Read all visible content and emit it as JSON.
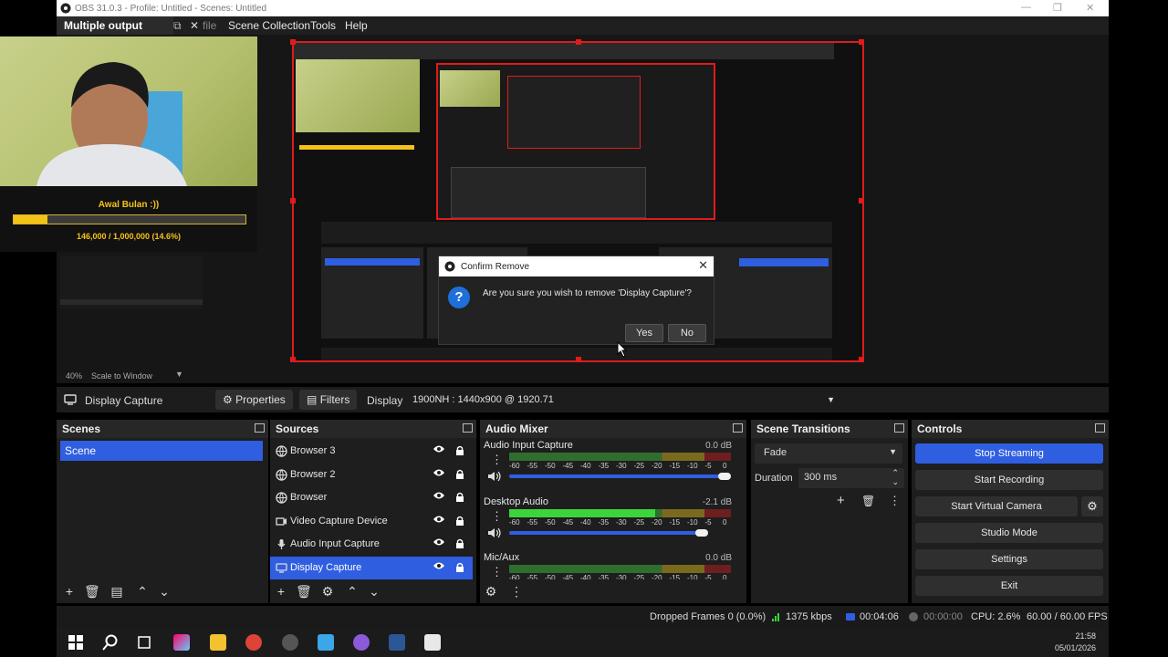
{
  "window": {
    "title": "OBS 31.0.3 - Profile: Untitled - Scenes: Untitled"
  },
  "menu": {
    "multiple_output": "Multiple output",
    "file": "file",
    "scene_collection": "Scene Collection",
    "tools": "Tools",
    "help": "Help"
  },
  "overlay": {
    "name": "Awal Bulan :))",
    "progress_text": "146,000 / 1,000,000 (14.6%)",
    "progress_fraction": 0.146
  },
  "dialog": {
    "title": "Confirm Remove",
    "message": "Are you sure you wish to remove 'Display Capture'?",
    "yes": "Yes",
    "no": "No"
  },
  "zoom": {
    "percent": "40%",
    "mode": "Scale to Window"
  },
  "source_toolbar": {
    "selected_source": "Display Capture",
    "properties": "Properties",
    "filters": "Filters",
    "display_label": "Display",
    "display_value": "1900NH     : 1440x900 @ 1920.71"
  },
  "scenes": {
    "title": "Scenes",
    "items": [
      "Scene"
    ]
  },
  "sources": {
    "title": "Sources",
    "items": [
      {
        "label": "Browser 3",
        "icon": "globe-icon"
      },
      {
        "label": "Browser 2",
        "icon": "globe-icon"
      },
      {
        "label": "Browser",
        "icon": "globe-icon"
      },
      {
        "label": "Video Capture Device",
        "icon": "camera-icon"
      },
      {
        "label": "Audio Input Capture",
        "icon": "microphone-icon"
      },
      {
        "label": "Display Capture",
        "icon": "monitor-icon"
      }
    ]
  },
  "mixer": {
    "title": "Audio Mixer",
    "ticks": [
      "-60",
      "-55",
      "-50",
      "-45",
      "-40",
      "-35",
      "-30",
      "-25",
      "-20",
      "-15",
      "-10",
      "-5",
      "0"
    ],
    "channels": [
      {
        "name": "Audio Input Capture",
        "db": "0.0 dB",
        "level": 0.0,
        "volume": 0.97
      },
      {
        "name": "Desktop Audio",
        "db": "-2.1 dB",
        "level": 0.66,
        "volume": 0.87
      },
      {
        "name": "Mic/Aux",
        "db": "0.0 dB",
        "level": 0.0,
        "volume": 0.97
      }
    ]
  },
  "transitions": {
    "title": "Scene Transitions",
    "type": "Fade",
    "duration_label": "Duration",
    "duration_value": "300 ms"
  },
  "controls": {
    "title": "Controls",
    "stop_streaming": "Stop Streaming",
    "start_recording": "Start Recording",
    "start_virtual_camera": "Start Virtual Camera",
    "studio_mode": "Studio Mode",
    "settings": "Settings",
    "exit": "Exit"
  },
  "status": {
    "dropped_frames": "Dropped Frames 0 (0.0%)",
    "bitrate": "1375 kbps",
    "stream_time": "00:04:06",
    "record_time": "00:00:00",
    "cpu": "CPU: 2.6%",
    "fps": "60.00 / 60.00 FPS"
  },
  "clock": {
    "time": "21:58",
    "date": "05/01/2026"
  },
  "colors": {
    "accent": "#2f5ee1",
    "red_border": "#e01b1b",
    "overlay_gold": "#f3c317"
  }
}
